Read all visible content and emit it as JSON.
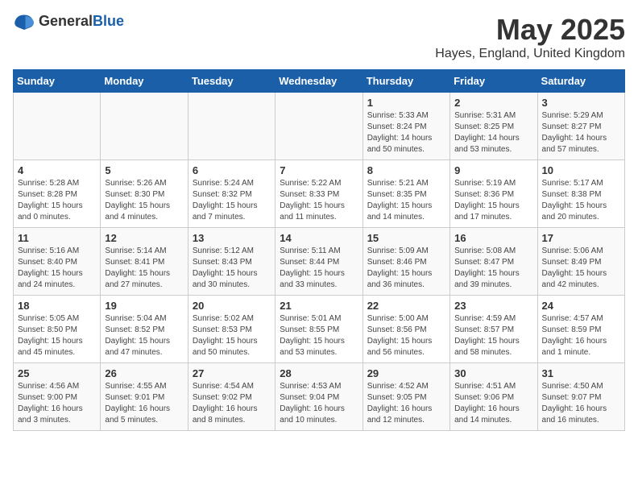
{
  "header": {
    "logo_general": "General",
    "logo_blue": "Blue",
    "title": "May 2025",
    "subtitle": "Hayes, England, United Kingdom"
  },
  "weekdays": [
    "Sunday",
    "Monday",
    "Tuesday",
    "Wednesday",
    "Thursday",
    "Friday",
    "Saturday"
  ],
  "weeks": [
    [
      {
        "day": "",
        "info": ""
      },
      {
        "day": "",
        "info": ""
      },
      {
        "day": "",
        "info": ""
      },
      {
        "day": "",
        "info": ""
      },
      {
        "day": "1",
        "info": "Sunrise: 5:33 AM\nSunset: 8:24 PM\nDaylight: 14 hours\nand 50 minutes."
      },
      {
        "day": "2",
        "info": "Sunrise: 5:31 AM\nSunset: 8:25 PM\nDaylight: 14 hours\nand 53 minutes."
      },
      {
        "day": "3",
        "info": "Sunrise: 5:29 AM\nSunset: 8:27 PM\nDaylight: 14 hours\nand 57 minutes."
      }
    ],
    [
      {
        "day": "4",
        "info": "Sunrise: 5:28 AM\nSunset: 8:28 PM\nDaylight: 15 hours\nand 0 minutes."
      },
      {
        "day": "5",
        "info": "Sunrise: 5:26 AM\nSunset: 8:30 PM\nDaylight: 15 hours\nand 4 minutes."
      },
      {
        "day": "6",
        "info": "Sunrise: 5:24 AM\nSunset: 8:32 PM\nDaylight: 15 hours\nand 7 minutes."
      },
      {
        "day": "7",
        "info": "Sunrise: 5:22 AM\nSunset: 8:33 PM\nDaylight: 15 hours\nand 11 minutes."
      },
      {
        "day": "8",
        "info": "Sunrise: 5:21 AM\nSunset: 8:35 PM\nDaylight: 15 hours\nand 14 minutes."
      },
      {
        "day": "9",
        "info": "Sunrise: 5:19 AM\nSunset: 8:36 PM\nDaylight: 15 hours\nand 17 minutes."
      },
      {
        "day": "10",
        "info": "Sunrise: 5:17 AM\nSunset: 8:38 PM\nDaylight: 15 hours\nand 20 minutes."
      }
    ],
    [
      {
        "day": "11",
        "info": "Sunrise: 5:16 AM\nSunset: 8:40 PM\nDaylight: 15 hours\nand 24 minutes."
      },
      {
        "day": "12",
        "info": "Sunrise: 5:14 AM\nSunset: 8:41 PM\nDaylight: 15 hours\nand 27 minutes."
      },
      {
        "day": "13",
        "info": "Sunrise: 5:12 AM\nSunset: 8:43 PM\nDaylight: 15 hours\nand 30 minutes."
      },
      {
        "day": "14",
        "info": "Sunrise: 5:11 AM\nSunset: 8:44 PM\nDaylight: 15 hours\nand 33 minutes."
      },
      {
        "day": "15",
        "info": "Sunrise: 5:09 AM\nSunset: 8:46 PM\nDaylight: 15 hours\nand 36 minutes."
      },
      {
        "day": "16",
        "info": "Sunrise: 5:08 AM\nSunset: 8:47 PM\nDaylight: 15 hours\nand 39 minutes."
      },
      {
        "day": "17",
        "info": "Sunrise: 5:06 AM\nSunset: 8:49 PM\nDaylight: 15 hours\nand 42 minutes."
      }
    ],
    [
      {
        "day": "18",
        "info": "Sunrise: 5:05 AM\nSunset: 8:50 PM\nDaylight: 15 hours\nand 45 minutes."
      },
      {
        "day": "19",
        "info": "Sunrise: 5:04 AM\nSunset: 8:52 PM\nDaylight: 15 hours\nand 47 minutes."
      },
      {
        "day": "20",
        "info": "Sunrise: 5:02 AM\nSunset: 8:53 PM\nDaylight: 15 hours\nand 50 minutes."
      },
      {
        "day": "21",
        "info": "Sunrise: 5:01 AM\nSunset: 8:55 PM\nDaylight: 15 hours\nand 53 minutes."
      },
      {
        "day": "22",
        "info": "Sunrise: 5:00 AM\nSunset: 8:56 PM\nDaylight: 15 hours\nand 56 minutes."
      },
      {
        "day": "23",
        "info": "Sunrise: 4:59 AM\nSunset: 8:57 PM\nDaylight: 15 hours\nand 58 minutes."
      },
      {
        "day": "24",
        "info": "Sunrise: 4:57 AM\nSunset: 8:59 PM\nDaylight: 16 hours\nand 1 minute."
      }
    ],
    [
      {
        "day": "25",
        "info": "Sunrise: 4:56 AM\nSunset: 9:00 PM\nDaylight: 16 hours\nand 3 minutes."
      },
      {
        "day": "26",
        "info": "Sunrise: 4:55 AM\nSunset: 9:01 PM\nDaylight: 16 hours\nand 5 minutes."
      },
      {
        "day": "27",
        "info": "Sunrise: 4:54 AM\nSunset: 9:02 PM\nDaylight: 16 hours\nand 8 minutes."
      },
      {
        "day": "28",
        "info": "Sunrise: 4:53 AM\nSunset: 9:04 PM\nDaylight: 16 hours\nand 10 minutes."
      },
      {
        "day": "29",
        "info": "Sunrise: 4:52 AM\nSunset: 9:05 PM\nDaylight: 16 hours\nand 12 minutes."
      },
      {
        "day": "30",
        "info": "Sunrise: 4:51 AM\nSunset: 9:06 PM\nDaylight: 16 hours\nand 14 minutes."
      },
      {
        "day": "31",
        "info": "Sunrise: 4:50 AM\nSunset: 9:07 PM\nDaylight: 16 hours\nand 16 minutes."
      }
    ]
  ]
}
